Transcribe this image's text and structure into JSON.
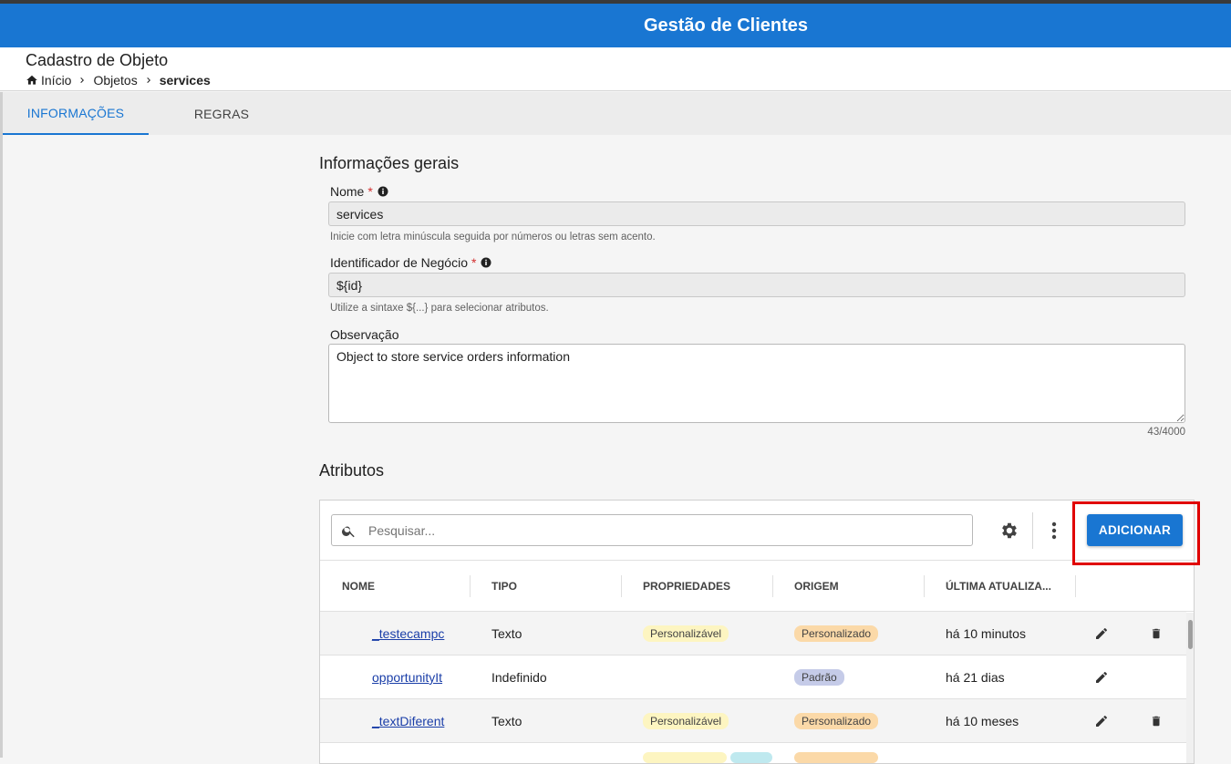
{
  "app": {
    "title": "Gestão de Clientes"
  },
  "header": {
    "page_title": "Cadastro de Objeto",
    "breadcrumb": [
      {
        "label": "Início"
      },
      {
        "label": "Objetos"
      },
      {
        "label": "services"
      }
    ]
  },
  "tabs": [
    {
      "label": "INFORMAÇÕES",
      "active": true
    },
    {
      "label": "REGRAS",
      "active": false
    }
  ],
  "general": {
    "title": "Informações gerais",
    "nome": {
      "label": "Nome",
      "value": "services",
      "helper": "Inicie com letra minúscula seguida por números ou letras sem acento."
    },
    "identificador": {
      "label": "Identificador de Negócio",
      "value": "${id}",
      "helper": "Utilize a sintaxe ${...} para selecionar atributos."
    },
    "observacao": {
      "label": "Observação",
      "value": "Object to store service orders information",
      "counter": "43/4000"
    },
    "required_mark": "*"
  },
  "attributes": {
    "title": "Atributos",
    "search_placeholder": "Pesquisar...",
    "add_label": "ADICIONAR",
    "columns": [
      "NOME",
      "TIPO",
      "PROPRIEDADES",
      "ORIGEM",
      "ÚLTIMA ATUALIZA..."
    ],
    "rows": [
      {
        "name": "_testecampc",
        "type": "Texto",
        "property": "Personalizável",
        "origin": "Personalizado",
        "updated": "há 10 minutos",
        "deletable": true
      },
      {
        "name": "opportunityIt",
        "type": "Indefinido",
        "property": "",
        "origin": "Padrão",
        "updated": "há 21 dias",
        "deletable": false
      },
      {
        "name": "_textDiferent",
        "type": "Texto",
        "property": "Personalizável",
        "origin": "Personalizado",
        "updated": "há 10 meses",
        "deletable": true
      }
    ]
  },
  "colors": {
    "primary": "#1976d2",
    "highlight": "#e00000",
    "chip_yellow": "#fdf5c1",
    "chip_orange": "#fbd9a8",
    "chip_lavender": "#c5cbe8"
  },
  "icons": [
    "home-icon",
    "chevron-right-icon",
    "info-icon",
    "search-icon",
    "gear-icon",
    "more-vert-icon",
    "pencil-icon",
    "trash-icon"
  ]
}
